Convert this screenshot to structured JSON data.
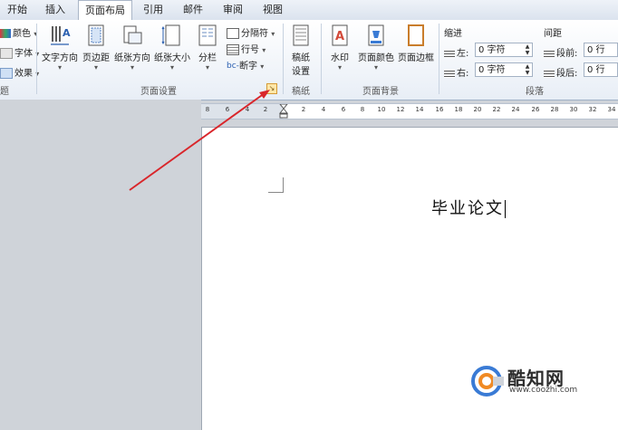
{
  "tabs": [
    {
      "label": "开始"
    },
    {
      "label": "插入"
    },
    {
      "label": "页面布局",
      "active": true
    },
    {
      "label": "引用"
    },
    {
      "label": "邮件"
    },
    {
      "label": "审阅"
    },
    {
      "label": "视图"
    }
  ],
  "theme_group": {
    "colors_label": "颜色",
    "fonts_label": "字体",
    "effects_label": "效果",
    "group_label": "题"
  },
  "page_setup": {
    "group_label": "页面设置",
    "buttons": [
      {
        "label": "文字方向",
        "icon": "text-direction-icon"
      },
      {
        "label": "页边距",
        "icon": "margins-icon"
      },
      {
        "label": "纸张方向",
        "icon": "orientation-icon"
      },
      {
        "label": "纸张大小",
        "icon": "paper-size-icon"
      },
      {
        "label": "分栏",
        "icon": "columns-icon"
      }
    ],
    "small_buttons": [
      {
        "label": "分隔符",
        "icon": "breaks-icon"
      },
      {
        "label": "行号",
        "icon": "line-numbers-icon"
      },
      {
        "label": "断字",
        "icon": "hyphenation-icon"
      }
    ],
    "launcher_icon": "dialog-launcher-icon"
  },
  "manuscript": {
    "group_label": "稿纸",
    "button_label": [
      "稿纸",
      "设置"
    ]
  },
  "page_background": {
    "group_label": "页面背景",
    "buttons": [
      {
        "label": "水印",
        "icon": "watermark-icon"
      },
      {
        "label": "页面颜色",
        "icon": "page-color-icon"
      },
      {
        "label": "页面边框",
        "icon": "page-borders-icon"
      }
    ]
  },
  "paragraph": {
    "group_label": "段落",
    "indent_label": "缩进",
    "spacing_label": "间距",
    "left_label": "左:",
    "right_label": "右:",
    "before_label": "段前:",
    "after_label": "段后:",
    "left_value": "0 字符",
    "right_value": "0 字符",
    "before_value": "0 行",
    "after_value": "0 行"
  },
  "ruler": {
    "ticks": [
      "8",
      "6",
      "4",
      "2",
      "2",
      "4",
      "6",
      "8",
      "10",
      "12",
      "14",
      "16",
      "18",
      "20",
      "22",
      "24",
      "26",
      "28",
      "30",
      "32",
      "34"
    ]
  },
  "document": {
    "text": "毕业论文"
  },
  "watermark": {
    "name": "酷知网",
    "url": "www.coozhi.com"
  },
  "colors": {
    "arrow": "#d9262b",
    "ribbon_bg": "#f3f6fa",
    "active_tab": "#ffffff"
  }
}
